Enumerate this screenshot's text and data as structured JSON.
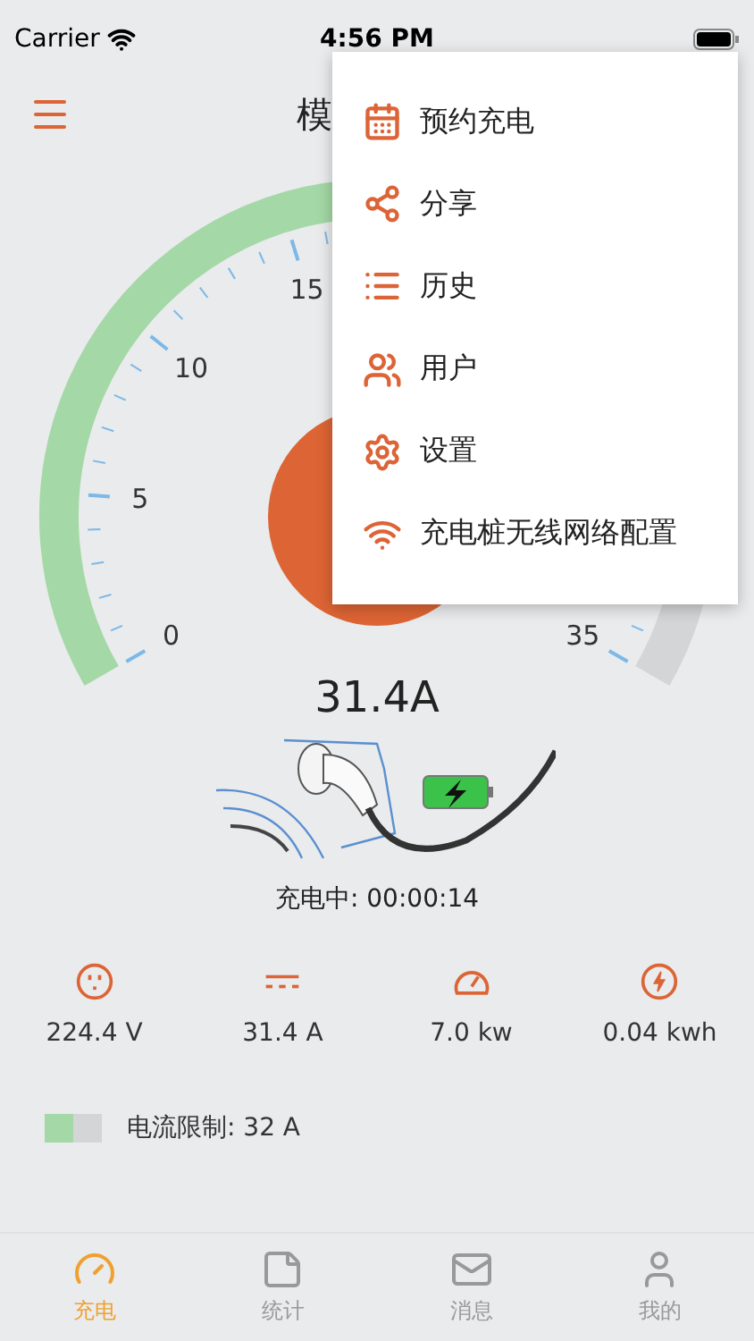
{
  "status_bar": {
    "carrier": "Carrier",
    "time": "4:56 PM"
  },
  "header": {
    "title": "模"
  },
  "gauge": {
    "labels": [
      {
        "text": "0"
      },
      {
        "text": "5"
      },
      {
        "text": "10"
      },
      {
        "text": "15"
      },
      {
        "text": "35"
      }
    ],
    "reading": "31.4A"
  },
  "charging_status": "充电中: 00:00:14",
  "stats": [
    {
      "kind": "voltage",
      "value": "224.4 V"
    },
    {
      "kind": "current",
      "value": "31.4 A"
    },
    {
      "kind": "power",
      "value": "7.0 kw"
    },
    {
      "kind": "energy",
      "value": "0.04 kwh"
    }
  ],
  "current_limit": "电流限制:  32 A",
  "menu": [
    {
      "kind": "schedule",
      "label": "预约充电"
    },
    {
      "kind": "share",
      "label": "分享"
    },
    {
      "kind": "history",
      "label": "历史"
    },
    {
      "kind": "users",
      "label": "用户"
    },
    {
      "kind": "settings",
      "label": "设置"
    },
    {
      "kind": "wifi",
      "label": "充电桩无线网络配置"
    }
  ],
  "tabs": [
    {
      "kind": "charge",
      "label": "充电",
      "selected": true
    },
    {
      "kind": "stats",
      "label": "统计",
      "selected": false
    },
    {
      "kind": "messages",
      "label": "消息",
      "selected": false
    },
    {
      "kind": "me",
      "label": "我的",
      "selected": false
    }
  ]
}
